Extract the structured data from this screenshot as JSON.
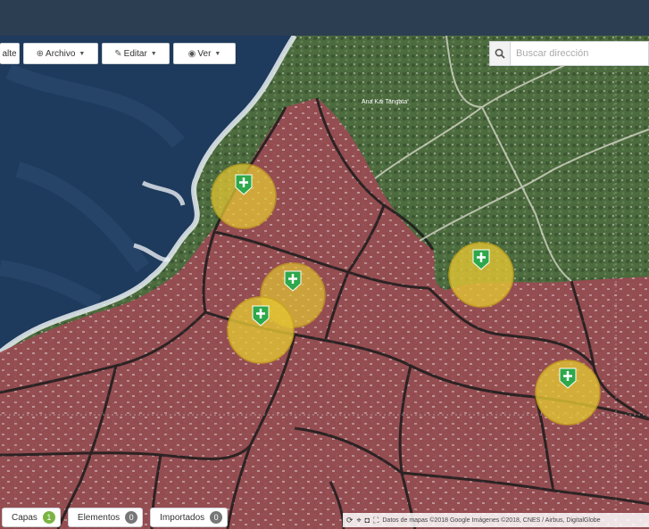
{
  "toolbar": {
    "partial_label": "alte",
    "archivo_label": "Archivo",
    "editar_label": "Editar",
    "ver_label": "Ver",
    "icons": [
      "folder-icon",
      "pencil-icon",
      "eye-icon",
      "chevron-down-icon"
    ]
  },
  "search": {
    "placeholder": "Buscar dirección",
    "icon": "search-icon"
  },
  "map": {
    "places": [
      "Ana Kai Tangata"
    ],
    "markers": [
      {
        "name": "zone-marker-1",
        "icon": "medical-cross-icon",
        "color": "#2ea84a"
      },
      {
        "name": "zone-marker-2",
        "icon": "medical-cross-icon",
        "color": "#2ea84a"
      },
      {
        "name": "zone-marker-3",
        "icon": "medical-cross-icon",
        "color": "#2ea84a"
      },
      {
        "name": "zone-marker-4",
        "icon": "medical-cross-icon",
        "color": "#2ea84a"
      },
      {
        "name": "zone-marker-5",
        "icon": "medical-cross-icon",
        "color": "#2ea84a"
      }
    ],
    "zone_fill": "#e3c534",
    "area_fill": "#9a4b52"
  },
  "bottom": {
    "capas_label": "Capas",
    "capas_count": "1",
    "elementos_label": "Elementos",
    "elementos_count": "0",
    "importados_label": "Importados",
    "importados_count": "0"
  },
  "attribution": {
    "text": "Datos de mapas ©2018 Google Imágenes ©2018, CNES / Airbus, DigitalGlobe"
  }
}
